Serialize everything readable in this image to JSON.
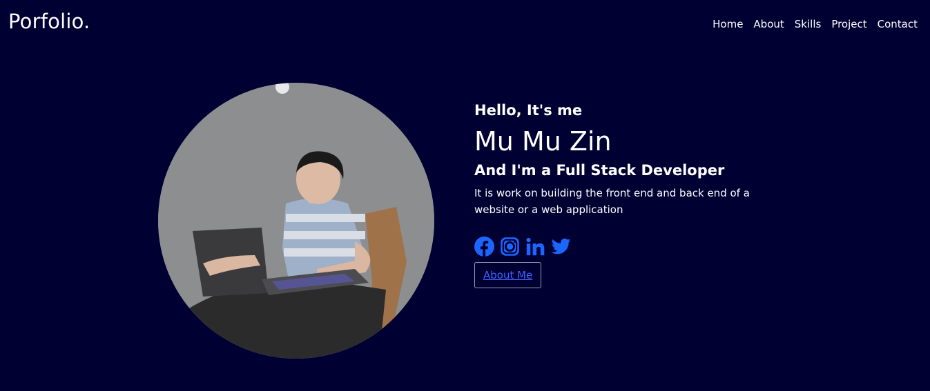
{
  "header": {
    "logo": "Porfolio.",
    "nav": [
      "Home",
      "About",
      "Skills",
      "Project",
      "Contact"
    ]
  },
  "hero": {
    "greeting": "Hello, It's me",
    "name": "Mu Mu Zin",
    "role": "And I'm a Full Stack Developer",
    "description": "It is work on building the front end and back end of a website or a web application",
    "socials": [
      "facebook-icon",
      "instagram-icon",
      "linkedin-icon",
      "twitter-icon"
    ],
    "button_label": "About Me"
  },
  "colors": {
    "background": "#000033",
    "text": "#ffffff",
    "accent": "#1a66ff",
    "link": "#3d63ff"
  }
}
